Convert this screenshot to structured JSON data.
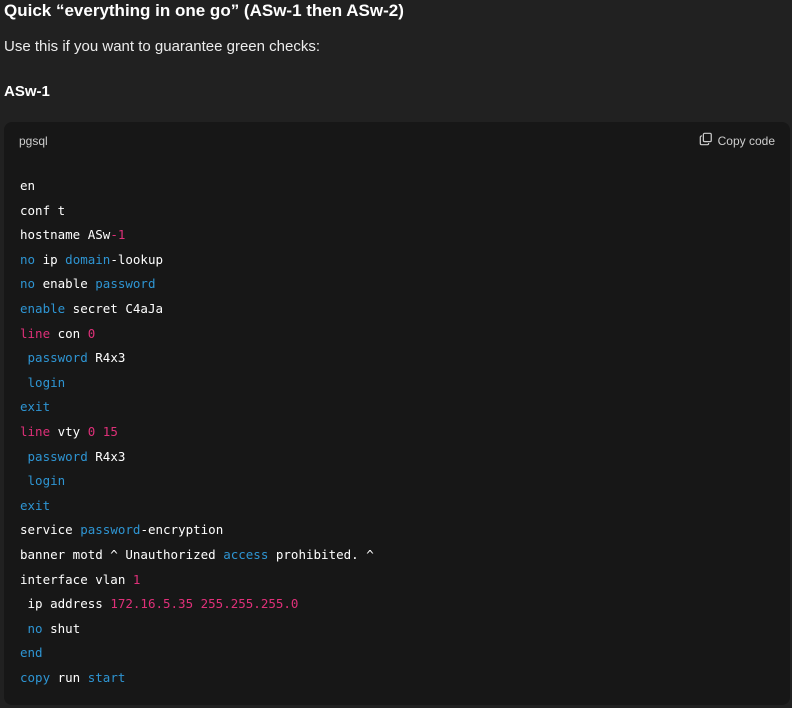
{
  "heading": "Quick “everything in one go” (ASw-1 then ASw-2)",
  "intro": "Use this if you want to guarantee green checks:",
  "subheading": "ASw-1",
  "code_block": {
    "language": "pgsql",
    "copy_label": "Copy code",
    "copy_icon": "copy-icon",
    "colors": {
      "background": "#171717",
      "text": "#ffffff",
      "keyword": "#2e95d3",
      "number": "#df3079"
    },
    "lines": [
      [
        {
          "t": "en",
          "c": "text"
        }
      ],
      [
        {
          "t": "conf t",
          "c": "text"
        }
      ],
      [
        {
          "t": "hostname ASw",
          "c": "text"
        },
        {
          "t": "-1",
          "c": "num"
        }
      ],
      [
        {
          "t": "no",
          "c": "kw"
        },
        {
          "t": " ip ",
          "c": "text"
        },
        {
          "t": "domain",
          "c": "kw"
        },
        {
          "t": "-lookup",
          "c": "text"
        }
      ],
      [
        {
          "t": "no",
          "c": "kw"
        },
        {
          "t": " enable ",
          "c": "text"
        },
        {
          "t": "password",
          "c": "kw"
        }
      ],
      [
        {
          "t": "enable",
          "c": "kw"
        },
        {
          "t": " secret C4aJa",
          "c": "text"
        }
      ],
      [
        {
          "t": "line",
          "c": "num"
        },
        {
          "t": " con ",
          "c": "text"
        },
        {
          "t": "0",
          "c": "num"
        }
      ],
      [
        {
          "t": " ",
          "c": "text"
        },
        {
          "t": "password",
          "c": "kw"
        },
        {
          "t": " R4x3",
          "c": "text"
        }
      ],
      [
        {
          "t": " ",
          "c": "text"
        },
        {
          "t": "login",
          "c": "kw"
        }
      ],
      [
        {
          "t": "exit",
          "c": "kw"
        }
      ],
      [
        {
          "t": "line",
          "c": "num"
        },
        {
          "t": " vty ",
          "c": "text"
        },
        {
          "t": "0 15",
          "c": "num"
        }
      ],
      [
        {
          "t": " ",
          "c": "text"
        },
        {
          "t": "password",
          "c": "kw"
        },
        {
          "t": " R4x3",
          "c": "text"
        }
      ],
      [
        {
          "t": " ",
          "c": "text"
        },
        {
          "t": "login",
          "c": "kw"
        }
      ],
      [
        {
          "t": "exit",
          "c": "kw"
        }
      ],
      [
        {
          "t": "service ",
          "c": "text"
        },
        {
          "t": "password",
          "c": "kw"
        },
        {
          "t": "-encryption",
          "c": "text"
        }
      ],
      [
        {
          "t": "banner motd ^ Unauthorized ",
          "c": "text"
        },
        {
          "t": "access",
          "c": "kw"
        },
        {
          "t": " prohibited. ^",
          "c": "text"
        }
      ],
      [
        {
          "t": "interface vlan ",
          "c": "text"
        },
        {
          "t": "1",
          "c": "num"
        }
      ],
      [
        {
          "t": " ip address ",
          "c": "text"
        },
        {
          "t": "172.16.5.35 255.255.255.0",
          "c": "num"
        }
      ],
      [
        {
          "t": " ",
          "c": "text"
        },
        {
          "t": "no",
          "c": "kw"
        },
        {
          "t": " shut",
          "c": "text"
        }
      ],
      [
        {
          "t": "end",
          "c": "kw"
        }
      ],
      [
        {
          "t": "copy",
          "c": "kw"
        },
        {
          "t": " run ",
          "c": "text"
        },
        {
          "t": "start",
          "c": "kw"
        }
      ]
    ]
  }
}
